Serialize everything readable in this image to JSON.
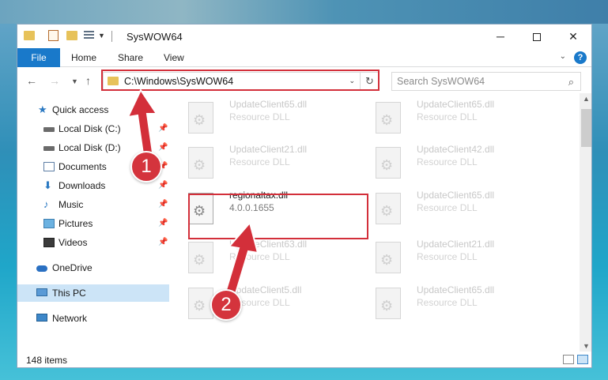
{
  "window": {
    "title": "SysWOW64",
    "controls": {
      "minimize": "─",
      "close": "✕"
    }
  },
  "ribbon": {
    "tabs": [
      "File",
      "Home",
      "Share",
      "View"
    ],
    "help": "?"
  },
  "address": {
    "path": "C:\\Windows\\SysWOW64",
    "search_placeholder": "Search SysWOW64"
  },
  "sidebar": {
    "items": [
      {
        "label": "Quick access",
        "icon": "star-icon"
      },
      {
        "label": "Local Disk (C:)",
        "icon": "disk-icon",
        "pinned": true
      },
      {
        "label": "Local Disk (D:)",
        "icon": "disk-icon",
        "pinned": true
      },
      {
        "label": "Documents",
        "icon": "documents-icon",
        "pinned": true
      },
      {
        "label": "Downloads",
        "icon": "download-icon",
        "pinned": true
      },
      {
        "label": "Music",
        "icon": "music-icon",
        "pinned": true
      },
      {
        "label": "Pictures",
        "icon": "pictures-icon",
        "pinned": true
      },
      {
        "label": "Videos",
        "icon": "videos-icon",
        "pinned": true
      },
      {
        "label": "OneDrive",
        "icon": "cloud-icon"
      },
      {
        "label": "This PC",
        "icon": "pc-icon",
        "selected": true
      },
      {
        "label": "Network",
        "icon": "network-icon"
      }
    ]
  },
  "files": [
    {
      "name": "UpdateClient65.dll",
      "sub": "Resource DLL"
    },
    {
      "name": "UpdateClient65.dll",
      "sub": "Resource DLL"
    },
    {
      "name": "UpdateClient21.dll",
      "sub": "Resource DLL"
    },
    {
      "name": "UpdateClient42.dll",
      "sub": "Resource DLL"
    },
    {
      "name": "regionaltax.dll",
      "sub": "4.0.0.1655",
      "highlighted": true
    },
    {
      "name": "UpdateClient65.dll",
      "sub": "Resource DLL"
    },
    {
      "name": "UpdateClient63.dll",
      "sub": "Resource DLL"
    },
    {
      "name": "UpdateClient21.dll",
      "sub": "Resource DLL"
    },
    {
      "name": "UpdateClient5.dll",
      "sub": "Resource DLL"
    },
    {
      "name": "UpdateClient65.dll",
      "sub": "Resource DLL"
    }
  ],
  "status": {
    "item_count": "148 items"
  },
  "annotations": {
    "step1": "1",
    "step2": "2",
    "color": "#d32f3a"
  }
}
